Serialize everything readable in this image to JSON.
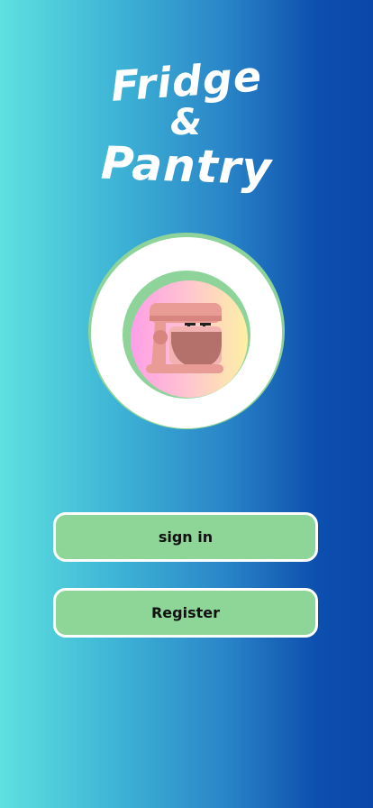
{
  "app": {
    "title_line1": "Fridge",
    "title_line2": "&",
    "title_line3": "Pantry",
    "logo_icon": "stand-mixer-icon"
  },
  "actions": {
    "sign_in_label": "sign in",
    "register_label": "Register"
  },
  "colors": {
    "gradient_left": "#5ee0e0",
    "gradient_right": "#0a47a8",
    "button_fill": "#8ed698",
    "button_border": "#ffffff",
    "logo_ring": "#8ed49a"
  }
}
